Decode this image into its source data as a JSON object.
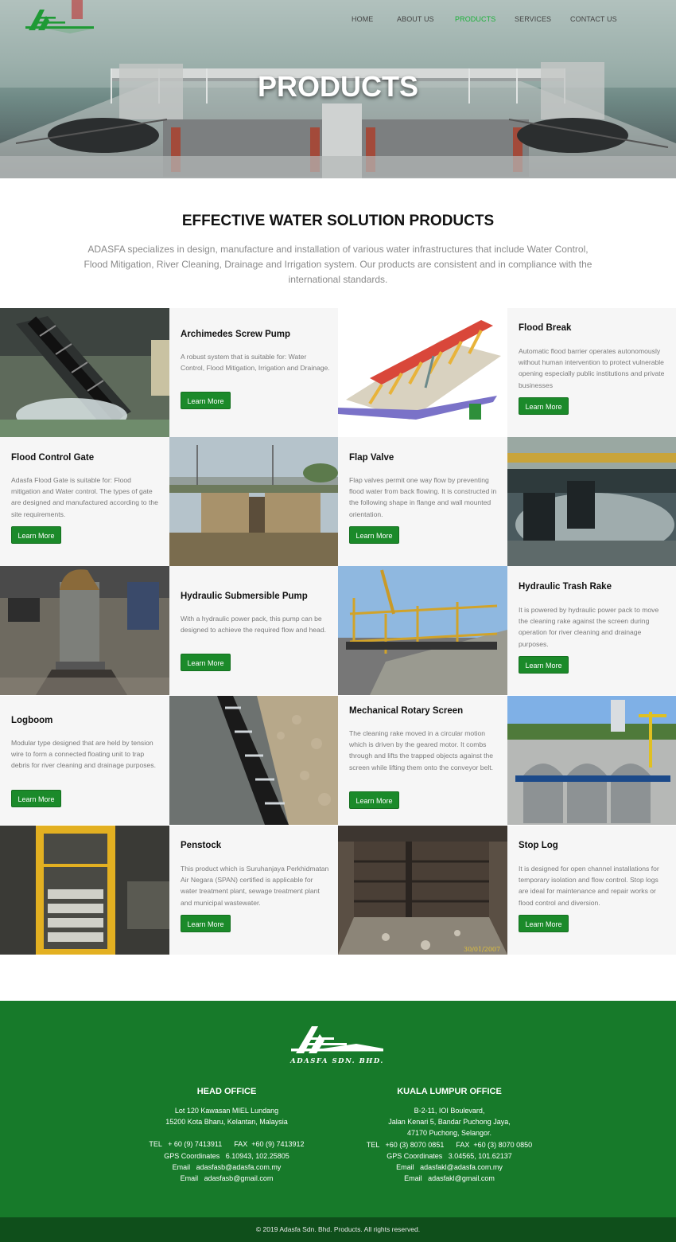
{
  "brand": {
    "name": "ADASFA SDN. BHD.",
    "accent": "#1b8a2a",
    "nav_active": "#1db03a",
    "footer_bg": "#177a2a"
  },
  "nav": [
    {
      "label": "HOME",
      "active": false
    },
    {
      "label": "ABOUT US",
      "active": false
    },
    {
      "label": "PRODUCTS",
      "active": true
    },
    {
      "label": "SERVICES",
      "active": false
    },
    {
      "label": "CONTACT US",
      "active": false
    }
  ],
  "hero": {
    "title": "PRODUCTS"
  },
  "intro": {
    "title": "EFFECTIVE WATER SOLUTION PRODUCTS",
    "text": "ADASFA specializes in design, manufacture and installation of various water infrastructures that include Water Control, Flood Mitigation, River Cleaning, Drainage and Irrigation system. Our products are consistent and in compliance with the international standards."
  },
  "products": [
    {
      "name": "Archimedes Screw Pump",
      "desc": "A robust system that is suitable for: Water Control, Flood Mitigation, Irrigation and Drainage.",
      "button": "Learn More",
      "image": "screw-pump-photo"
    },
    {
      "name": "Flood Break",
      "desc": "Automatic flood barrier operates autonomously without human intervention to protect vulnerable opening especially public institutions and private businesses",
      "button": "Learn More",
      "image": "flood-break-render"
    },
    {
      "name": "Flood Control Gate",
      "desc": "Adasfa Flood Gate is suitable for: Flood mitigation and Water control. The types of gate are designed and manufactured according to the site requirements.",
      "button": "Learn More",
      "image": "flood-gate-photo"
    },
    {
      "name": "Flap Valve",
      "desc": "Flap valves permit one way flow by preventing flood water from back flowing. It is constructed in the following shape in flange and wall mounted orientation.",
      "button": "Learn More",
      "image": "flap-valve-photo"
    },
    {
      "name": "Hydraulic Submersible Pump",
      "desc": "With a hydraulic power pack, this pump can be designed to achieve the required flow and head.",
      "button": "Learn More",
      "image": "submersible-pump-photo"
    },
    {
      "name": "Hydraulic Trash Rake",
      "desc": "It is powered by hydraulic power pack to move the cleaning rake against the screen during operation for river cleaning and drainage purposes.",
      "button": "Learn More",
      "image": "trash-rake-photo"
    },
    {
      "name": "Logboom",
      "desc": "Modular type designed that are held by tension wire to form a connected floating unit to trap debris for river cleaning and drainage purposes.",
      "button": "Learn More",
      "image": "logboom-photo"
    },
    {
      "name": "Mechanical Rotary Screen",
      "desc": "The cleaning rake moved in a circular motion which is driven by the geared motor. It combs through and lifts the trapped objects against the screen while lifting them onto the conveyor belt.",
      "button": "Learn More",
      "image": "rotary-screen-photo"
    },
    {
      "name": "Penstock",
      "desc": "This product which is Suruhanjaya Perkhidmatan Air Negara (SPAN) certified is applicable for water treatment plant, sewage treatment plant and municipal wastewater.",
      "button": "Learn More",
      "image": "penstock-photo"
    },
    {
      "name": "Stop Log",
      "desc": "It is designed for open channel installations for temporary isolation and flow control. Stop logs are ideal for maintenance and repair works or flood control and diversion.",
      "button": "Learn More",
      "image": "stop-log-photo"
    }
  ],
  "photo_stamp": "30/01/2007",
  "footer": {
    "logo_text": "ADASFA SDN. BHD.",
    "head_office": {
      "title": "HEAD OFFICE",
      "address1": "Lot 120 Kawasan MIEL Lundang",
      "address2": "15200 Kota Bharu, Kelantan, Malaysia",
      "tel_fax": "TEL   + 60 (9) 7413911      FAX  +60 (9) 7413912",
      "gps": "GPS Coordinates   6.10943, 102.25805",
      "email1": "Email   adasfasb@adasfa.com.my",
      "email2": "Email   adasfasb@gmail.com"
    },
    "kl_office": {
      "title": "KUALA LUMPUR OFFICE",
      "address1": "B-2-11, IOI Boulevard,",
      "address2": "Jalan Kenari 5, Bandar Puchong Jaya,",
      "address3": "47170 Puchong, Selangor.",
      "tel_fax": "TEL   +60 (3) 8070 0851      FAX  +60 (3) 8070 0850",
      "gps": "GPS Coordinates   3.04565, 101.62137",
      "email1": "Email   adasfakl@adasfa.com.my",
      "email2": "Email   adasfakl@gmail.com"
    },
    "copyright": "© 2019 Adasfa Sdn. Bhd. Products. All rights reserved."
  }
}
